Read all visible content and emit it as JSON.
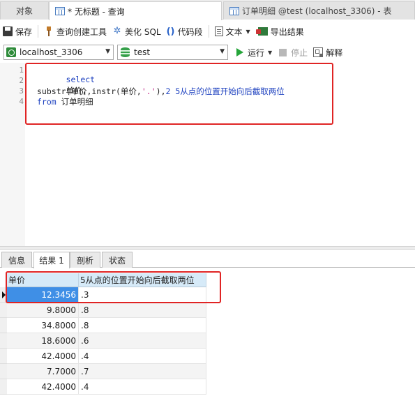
{
  "tabs": {
    "objects": "对象",
    "query": "* 无标题 - 查询",
    "table": "订单明细 @test (localhost_3306) - 表"
  },
  "toolbar": {
    "save": "保存",
    "query_builder": "查询创建工具",
    "beautify": "美化 SQL",
    "snippet": "代码段",
    "text": "文本",
    "export": "导出结果",
    "snippet_icon": "()"
  },
  "toolbar2": {
    "connection": "localhost_3306",
    "database": "test",
    "run": "运行",
    "stop": "停止",
    "explain": "解释"
  },
  "editor": {
    "line_numbers": [
      "1",
      "2",
      "3",
      "4"
    ],
    "lines": {
      "l1": "select",
      "l2": "单价,",
      "l3_pre": "substr(单价,instr(单价,",
      "l3_str": "'.'",
      "l3_mid": "),",
      "l3_num": "2",
      "l3_alias": " 5从点的位置开始向后截取两位",
      "l4_kw": "from",
      "l4_rest": " 订单明细"
    }
  },
  "result_tabs": [
    "信息",
    "结果 1",
    "剖析",
    "状态"
  ],
  "grid": {
    "columns": [
      "单价",
      "5从点的位置开始向后截取两位"
    ],
    "rows": [
      [
        "12.3456",
        ".3"
      ],
      [
        "9.8000",
        ".8"
      ],
      [
        "34.8000",
        ".8"
      ],
      [
        "18.6000",
        ".6"
      ],
      [
        "42.4000",
        ".4"
      ],
      [
        "7.7000",
        ".7"
      ],
      [
        "42.4000",
        ".4"
      ]
    ]
  },
  "colors": {
    "highlight": "#e02424",
    "keyword": "#1b3fbf",
    "string": "#c42e88",
    "header_bg": "#d6eaf8",
    "selected_cell": "#3f8fe6"
  }
}
